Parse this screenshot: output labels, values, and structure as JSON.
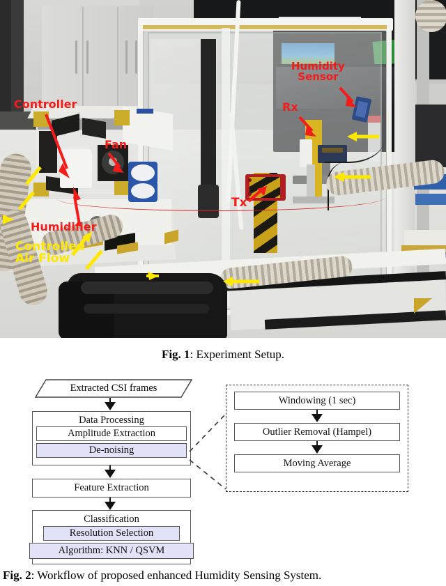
{
  "figure1": {
    "caption_label": "Fig. 1",
    "caption_sep": ": ",
    "caption_text": "Experiment Setup.",
    "annotations": [
      {
        "id": "controller",
        "label": "Controller",
        "color": "#f41b1b"
      },
      {
        "id": "fan",
        "label": "Fan",
        "color": "#f41b1b"
      },
      {
        "id": "humidifier",
        "label": "Humidifier",
        "color": "#f41b1b"
      },
      {
        "id": "humidity-sensor",
        "label": "Humidity\nSensor",
        "color": "#f41b1b"
      },
      {
        "id": "rx",
        "label": "Rx",
        "color": "#f41b1b"
      },
      {
        "id": "tx",
        "label": "Tx",
        "color": "#f41b1b"
      },
      {
        "id": "controlled-air-flow",
        "label": "Controlled\nAir Flow",
        "color": "#ffe800"
      }
    ],
    "colors": {
      "annotation_red": "#f41b1b",
      "annotation_yellow": "#ffe800",
      "airflow_arrow": "#ffe800"
    }
  },
  "figure2": {
    "caption_label": "Fig. 2",
    "caption_sep": ": ",
    "caption_text": "Workflow of proposed enhanced Humidity Sensing System.",
    "colors": {
      "highlight_fill": "#e2e2f8",
      "box_border": "#555555",
      "dashed_border": "#333333"
    },
    "main_flow": {
      "input": "Extracted CSI frames",
      "stages": [
        {
          "id": "data-processing",
          "title": "Data Processing",
          "substeps": [
            {
              "label": "Amplitude Extraction",
              "highlighted": false
            },
            {
              "label": "De-noising",
              "highlighted": true
            }
          ]
        },
        {
          "id": "feature-extraction",
          "title": "Feature Extraction",
          "substeps": []
        },
        {
          "id": "classification",
          "title": "Classification",
          "substeps": [
            {
              "label": "Resolution Selection",
              "highlighted": true
            },
            {
              "label": "Algorithm: KNN / QSVM",
              "highlighted": true
            }
          ]
        }
      ]
    },
    "detail_panel": {
      "id": "de-noising-detail",
      "steps": [
        "Windowing (1 sec)",
        "Outlier Removal (Hampel)",
        "Moving Average"
      ]
    }
  }
}
